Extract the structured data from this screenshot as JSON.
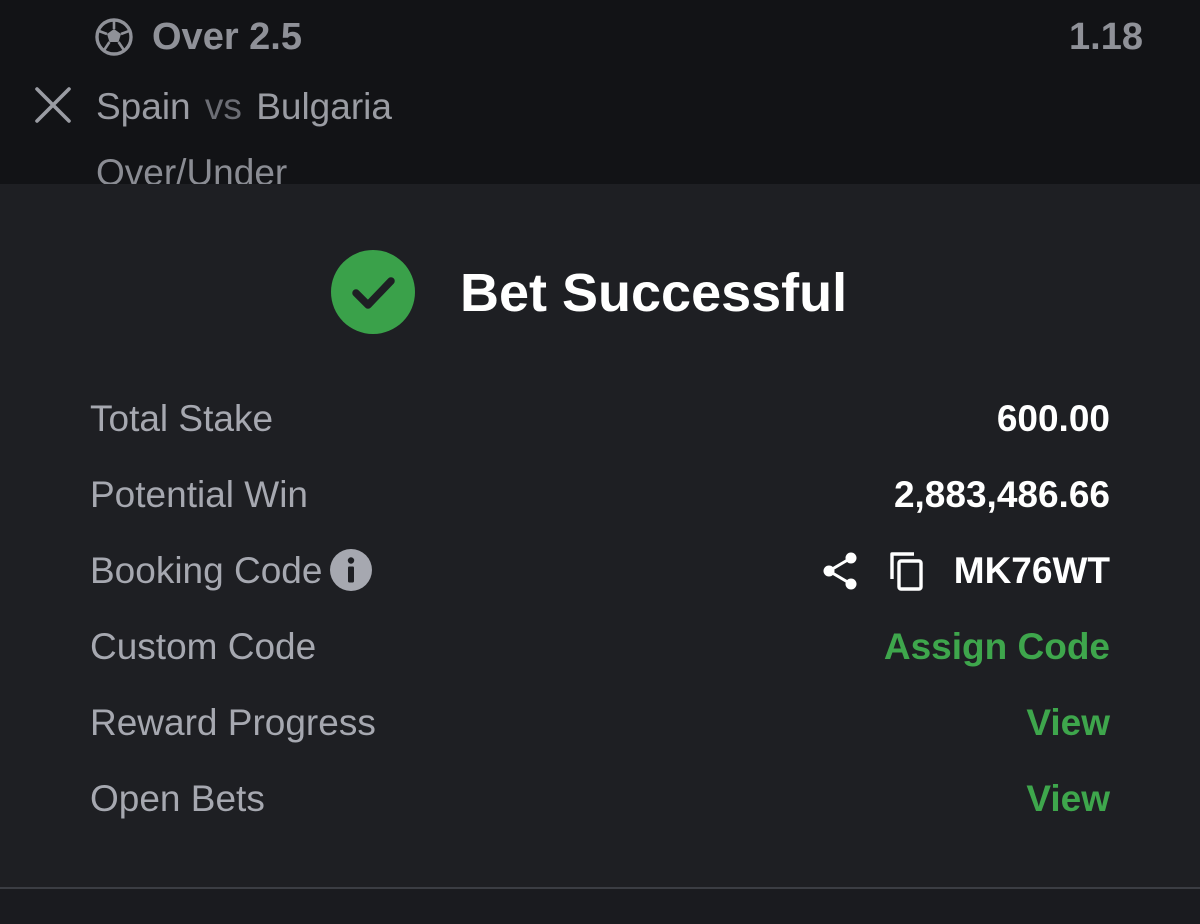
{
  "selection": {
    "title": "Over 2.5",
    "odds": "1.18",
    "home_team": "Spain",
    "vs": "vs",
    "away_team": "Bulgaria",
    "market": "Over/Under",
    "sport_icon": "soccer-ball-icon",
    "remove_icon": "close-icon"
  },
  "success": {
    "title": "Bet Successful",
    "icon": "check-circle-icon",
    "accent_color": "#3aa14a"
  },
  "details": {
    "total_stake": {
      "label": "Total Stake",
      "value": "600.00"
    },
    "potential_win": {
      "label": "Potential Win",
      "value": "2,883,486.66"
    },
    "booking_code": {
      "label": "Booking Code",
      "value": "MK76WT",
      "info_icon": "info-icon",
      "share_icon": "share-icon",
      "copy_icon": "copy-icon"
    },
    "custom_code": {
      "label": "Custom Code",
      "value": "Assign Code"
    },
    "reward_progress": {
      "label": "Reward Progress",
      "value": "View"
    },
    "open_bets": {
      "label": "Open Bets",
      "value": "View"
    }
  },
  "colors": {
    "background_dim": "#121316",
    "sheet": "#1e1f23",
    "label": "#a6a8b0",
    "value": "#ffffff",
    "link_green": "#3ea64c"
  }
}
